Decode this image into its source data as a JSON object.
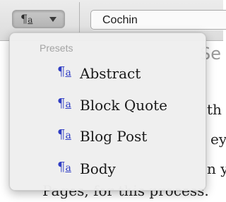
{
  "toolbar": {
    "style_icon": "paragraph-style-icon",
    "style_glyph": "¶",
    "style_glyph_letter": "a",
    "font_name": "Cochin"
  },
  "document": {
    "title_fragment": "Se",
    "lines": [
      "th",
      "ey",
      "n y",
      "Pages, for this process."
    ]
  },
  "presets_menu": {
    "header": "Presets",
    "icon_glyph": "¶",
    "icon_letter": "a",
    "icon_color": "#2f3dc4",
    "items": [
      {
        "label": "Abstract"
      },
      {
        "label": "Block Quote"
      },
      {
        "label": "Blog Post"
      },
      {
        "label": "Body"
      }
    ]
  }
}
